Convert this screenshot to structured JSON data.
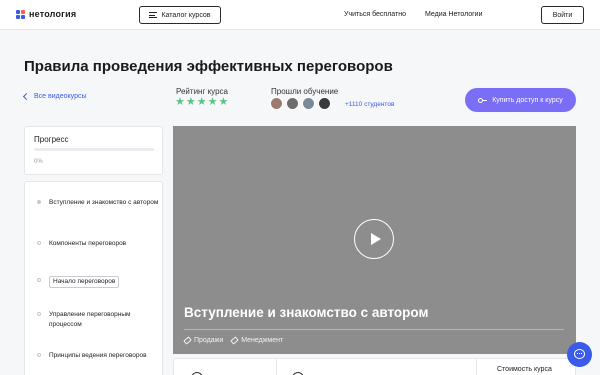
{
  "header": {
    "logo_text": "нетология",
    "catalog_label": "Каталог курсов",
    "nav": [
      "Учиться бесплатно",
      "Медиа Нетологии"
    ],
    "login_label": "Войти"
  },
  "course": {
    "title": "Правила проведения эффективных переговоров",
    "back_label": "Все видеокурсы",
    "rating_label": "Рейтинг курса",
    "rating_stars": 5,
    "passed_label": "Прошли обучение",
    "students_label": "+1110 студентов",
    "buy_label": "Купить доступ к курсу"
  },
  "progress": {
    "title": "Прогресс",
    "percent_label": "0%",
    "value": 0
  },
  "lessons": [
    "Вступление и знакомство с автором",
    "Компоненты переговоров",
    "Начало переговоров",
    "Управление переговорным процессом",
    "Принципы ведения переговоров"
  ],
  "video": {
    "title": "Вступление и знакомство с автором",
    "tags": [
      "Продажи",
      "Менеджмент"
    ]
  },
  "bottom": {
    "cost_label": "Стоимость курса"
  },
  "icons": {
    "logo": "netology-logo-icon",
    "catalog": "menu-icon",
    "back": "chevron-left-icon",
    "star": "star-icon",
    "buy": "key-icon",
    "play": "play-icon",
    "tag": "tag-icon",
    "chat": "chat-icon"
  },
  "colors": {
    "accent": "#3a5ae8",
    "buy_button": "#7b6ef6",
    "star": "#5cc28a",
    "video_placeholder": "#8d8d8d"
  }
}
